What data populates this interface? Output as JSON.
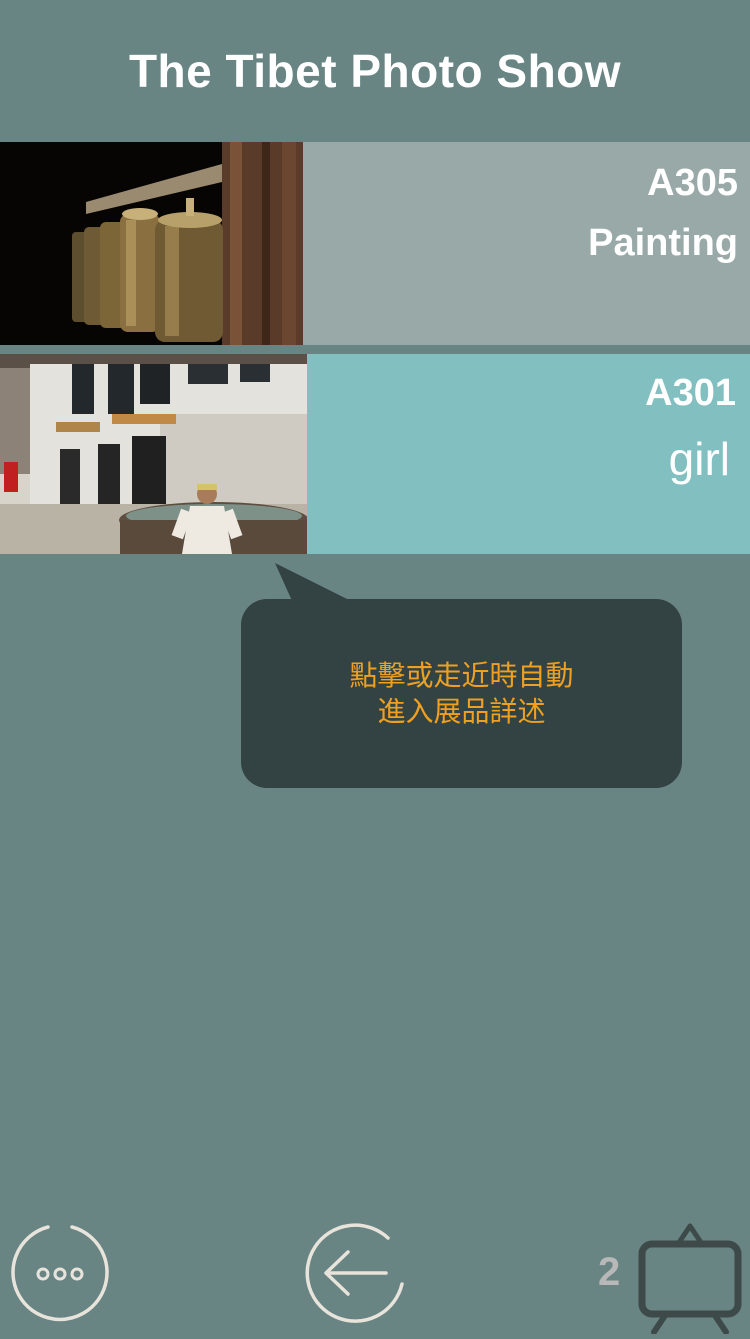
{
  "header": {
    "title": "The Tibet Photo Show"
  },
  "exhibits": [
    {
      "code": "A305",
      "name": "Painting",
      "background": "#99a9a8",
      "image": "prayer-wheels-photo"
    },
    {
      "code": "A301",
      "name": "girl",
      "background": "#82bfc0",
      "image": "tibetan-girl-courtyard-photo"
    }
  ],
  "tooltip": {
    "text": "點擊或走近時自動進入展品詳述",
    "text_color": "#f0a020",
    "background": "#334242"
  },
  "footer": {
    "menu_icon": "more-dots-icon",
    "back_icon": "back-arrow-icon",
    "page_count": "2",
    "board_icon": "display-board-icon"
  },
  "colors": {
    "background": "#688583",
    "header_text": "#ffffff"
  }
}
